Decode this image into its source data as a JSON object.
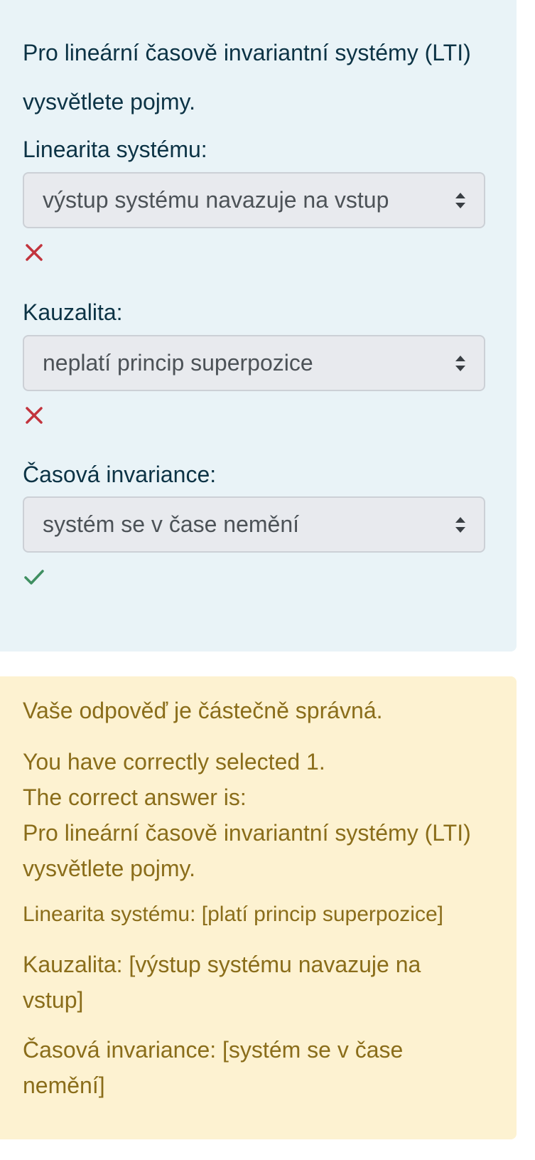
{
  "question": {
    "prompt": "Pro lineární časově invariantní systémy (LTI) vysvětlete pojmy.",
    "items": [
      {
        "label": "Linearita systému:",
        "selected": "výstup systému navazuje na vstup",
        "result": "incorrect",
        "result_icon": "cross-icon"
      },
      {
        "label": "Kauzalita:",
        "selected": "neplatí princip superpozice",
        "result": "incorrect",
        "result_icon": "cross-icon"
      },
      {
        "label": "Časová invariance:",
        "selected": "systém se v čase nemění",
        "result": "correct",
        "result_icon": "check-icon"
      }
    ]
  },
  "feedback": {
    "status": "Vaše odpověď je částečně správná.",
    "selected_count": "You have correctly selected 1.",
    "correct_intro": "The correct answer is:",
    "correct_prompt": "Pro lineární časově invariantní systémy (LTI) vysvětlete pojmy.",
    "answers": [
      "Linearita systému: [platí princip superpozice]",
      "Kauzalita: [výstup systému navazuje na vstup]",
      "Časová invariance: [systém se v čase nemění]"
    ]
  },
  "colors": {
    "question_bg": "#e9f3f7",
    "feedback_bg": "#fdf2d1",
    "incorrect": "#c2343d",
    "correct": "#3f8f61",
    "feedback_text": "#8a6d1a"
  }
}
